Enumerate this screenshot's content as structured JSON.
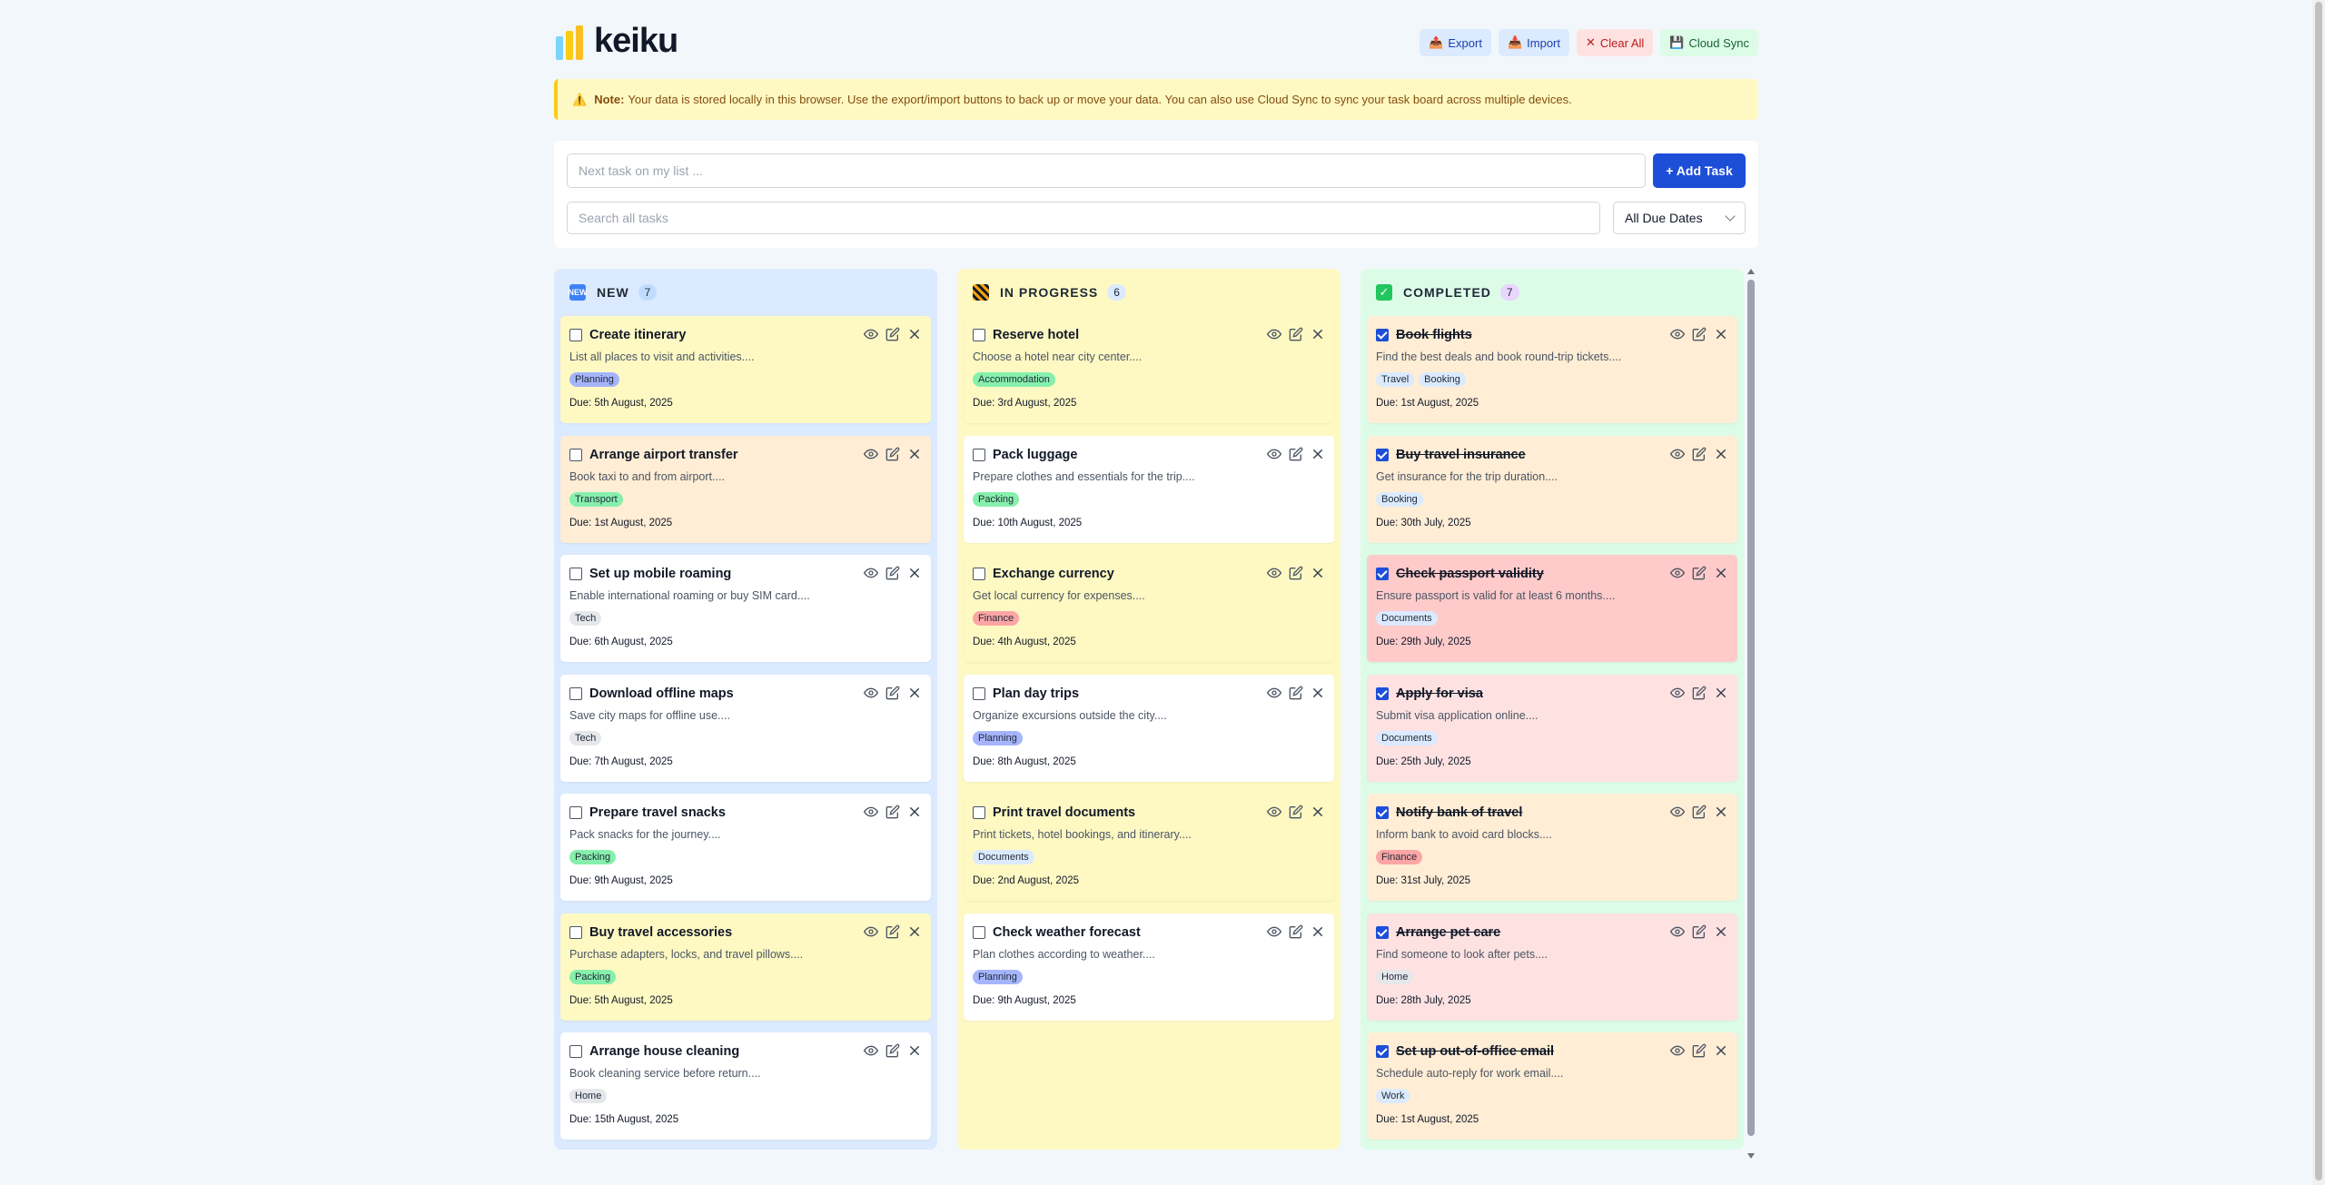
{
  "app": {
    "name": "keiku"
  },
  "header": {
    "export_label": "Export",
    "import_label": "Import",
    "clear_label": "Clear All",
    "sync_label": "Cloud Sync"
  },
  "note": {
    "label": "Note:",
    "text": "Your data is stored locally in this browser. Use the export/import buttons to back up or move your data. You can also use Cloud Sync to sync your task board across multiple devices."
  },
  "task_input": {
    "placeholder": "Next task on my list ...",
    "add_label": "+ Add Task"
  },
  "search": {
    "placeholder": "Search all tasks"
  },
  "due_filter": {
    "selected": "All Due Dates"
  },
  "columns": [
    {
      "key": "new",
      "title": "NEW",
      "count": "7",
      "icon": "new-icon",
      "cards": [
        {
          "title": "Create itinerary",
          "desc": "List all places to visit and activities....",
          "tags": [
            "Planning"
          ],
          "due": "Due: 5th August, 2025",
          "color": "yellow",
          "done": false
        },
        {
          "title": "Arrange airport transfer",
          "desc": "Book taxi to and from airport....",
          "tags": [
            "Transport"
          ],
          "due": "Due: 1st August, 2025",
          "color": "orange",
          "done": false
        },
        {
          "title": "Set up mobile roaming",
          "desc": "Enable international roaming or buy SIM card....",
          "tags": [
            "Tech"
          ],
          "due": "Due: 6th August, 2025",
          "color": "white",
          "done": false
        },
        {
          "title": "Download offline maps",
          "desc": "Save city maps for offline use....",
          "tags": [
            "Tech"
          ],
          "due": "Due: 7th August, 2025",
          "color": "white",
          "done": false
        },
        {
          "title": "Prepare travel snacks",
          "desc": "Pack snacks for the journey....",
          "tags": [
            "Packing"
          ],
          "due": "Due: 9th August, 2025",
          "color": "white",
          "done": false
        },
        {
          "title": "Buy travel accessories",
          "desc": "Purchase adapters, locks, and travel pillows....",
          "tags": [
            "Packing"
          ],
          "due": "Due: 5th August, 2025",
          "color": "yellow",
          "done": false
        },
        {
          "title": "Arrange house cleaning",
          "desc": "Book cleaning service before return....",
          "tags": [
            "Home"
          ],
          "due": "Due: 15th August, 2025",
          "color": "white",
          "done": false
        }
      ]
    },
    {
      "key": "prog",
      "title": "IN PROGRESS",
      "count": "6",
      "icon": "construction-icon",
      "cards": [
        {
          "title": "Reserve hotel",
          "desc": "Choose a hotel near city center....",
          "tags": [
            "Accommodation"
          ],
          "due": "Due: 3rd August, 2025",
          "color": "yellow",
          "done": false
        },
        {
          "title": "Pack luggage",
          "desc": "Prepare clothes and essentials for the trip....",
          "tags": [
            "Packing"
          ],
          "due": "Due: 10th August, 2025",
          "color": "white",
          "done": false
        },
        {
          "title": "Exchange currency",
          "desc": "Get local currency for expenses....",
          "tags": [
            "Finance"
          ],
          "due": "Due: 4th August, 2025",
          "color": "yellow",
          "done": false
        },
        {
          "title": "Plan day trips",
          "desc": "Organize excursions outside the city....",
          "tags": [
            "Planning"
          ],
          "due": "Due: 8th August, 2025",
          "color": "white",
          "done": false
        },
        {
          "title": "Print travel documents",
          "desc": "Print tickets, hotel bookings, and itinerary....",
          "tags": [
            "Documents"
          ],
          "due": "Due: 2nd August, 2025",
          "color": "yellow",
          "done": false
        },
        {
          "title": "Check weather forecast",
          "desc": "Plan clothes according to weather....",
          "tags": [
            "Planning"
          ],
          "due": "Due: 9th August, 2025",
          "color": "white",
          "done": false
        }
      ]
    },
    {
      "key": "done",
      "title": "COMPLETED",
      "count": "7",
      "icon": "check-icon",
      "cards": [
        {
          "title": "Book flights",
          "desc": "Find the best deals and book round-trip tickets....",
          "tags": [
            "Travel",
            "Booking"
          ],
          "due": "Due: 1st August, 2025",
          "color": "orange",
          "done": true
        },
        {
          "title": "Buy travel insurance",
          "desc": "Get insurance for the trip duration....",
          "tags": [
            "Booking"
          ],
          "due": "Due: 30th July, 2025",
          "color": "orange",
          "done": true
        },
        {
          "title": "Check passport validity",
          "desc": "Ensure passport is valid for at least 6 months....",
          "tags": [
            "Documents"
          ],
          "due": "Due: 29th July, 2025",
          "color": "red",
          "done": true
        },
        {
          "title": "Apply for visa",
          "desc": "Submit visa application online....",
          "tags": [
            "Documents"
          ],
          "due": "Due: 25th July, 2025",
          "color": "pink",
          "done": true
        },
        {
          "title": "Notify bank of travel",
          "desc": "Inform bank to avoid card blocks....",
          "tags": [
            "Finance"
          ],
          "due": "Due: 31st July, 2025",
          "color": "orange",
          "done": true
        },
        {
          "title": "Arrange pet care",
          "desc": "Find someone to look after pets....",
          "tags": [
            "Home"
          ],
          "due": "Due: 28th July, 2025",
          "color": "pink",
          "done": true
        },
        {
          "title": "Set up out-of-office email",
          "desc": "Schedule auto-reply for work email....",
          "tags": [
            "Work"
          ],
          "due": "Due: 1st August, 2025",
          "color": "orange",
          "done": true
        }
      ]
    }
  ]
}
